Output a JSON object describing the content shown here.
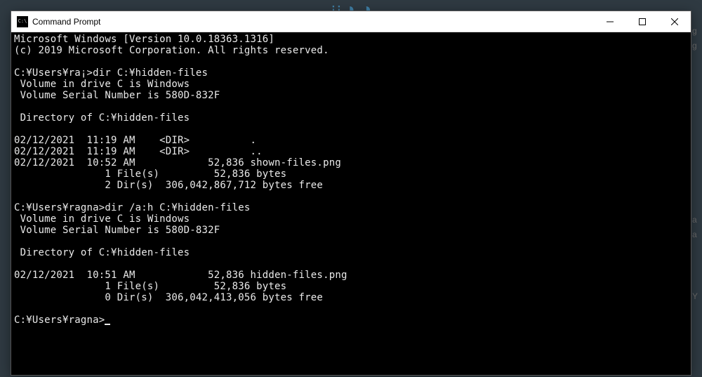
{
  "titlebar": {
    "icon_label": "C:\\",
    "title": "Command Prompt"
  },
  "terminal": {
    "lines": [
      "Microsoft Windows [Version 10.0.18363.1316]",
      "(c) 2019 Microsoft Corporation. All rights reserved.",
      "",
      "C:¥Users¥ra¡>dir C:¥hidden-files",
      " Volume in drive C is Windows",
      " Volume Serial Number is 580D-832F",
      "",
      " Directory of C:¥hidden-files",
      "",
      "02/12/2021  11:19 AM    <DIR>          .",
      "02/12/2021  11:19 AM    <DIR>          ..",
      "02/12/2021  10:52 AM            52,836 shown-files.png",
      "               1 File(s)         52,836 bytes",
      "               2 Dir(s)  306,042,867,712 bytes free",
      "",
      "C:¥Users¥ragna>dir /a:h C:¥hidden-files",
      " Volume in drive C is Windows",
      " Volume Serial Number is 580D-832F",
      "",
      " Directory of C:¥hidden-files",
      "",
      "02/12/2021  10:51 AM            52,836 hidden-files.png",
      "               1 File(s)         52,836 bytes",
      "               0 Dir(s)  306,042,413,056 bytes free",
      "",
      "C:¥Users¥ragna>"
    ]
  },
  "side_snippets": [
    "g",
    "g",
    "a",
    "a",
    "Y"
  ]
}
